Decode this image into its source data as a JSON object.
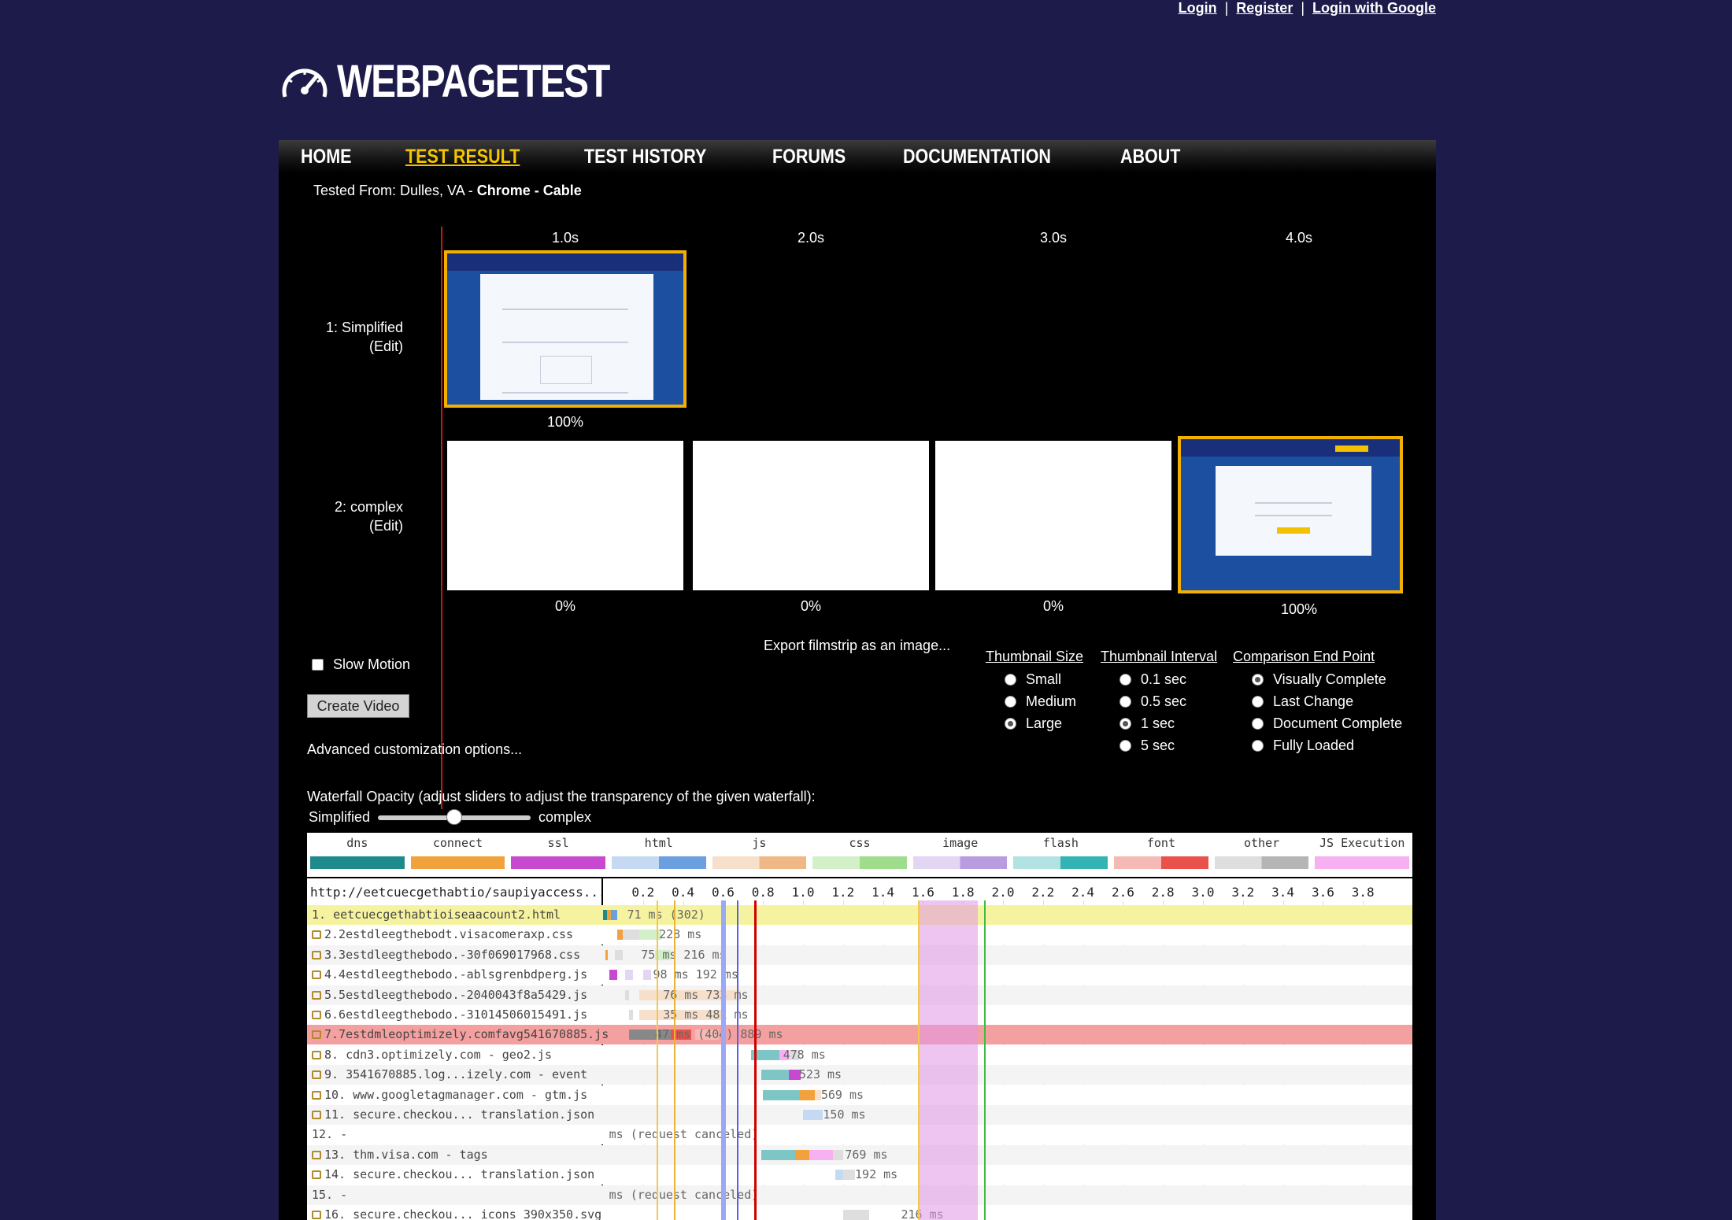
{
  "account": {
    "login": "Login",
    "register": "Register",
    "login_google": "Login with Google",
    "sep": "|"
  },
  "logo": {
    "text": "WEBPAGETEST",
    "icon": "speedometer-icon"
  },
  "nav": [
    "HOME",
    "TEST RESULT",
    "TEST HISTORY",
    "FORUMS",
    "DOCUMENTATION",
    "ABOUT"
  ],
  "nav_active": "TEST RESULT",
  "tested_from": {
    "prefix": "Tested From: Dulles, VA - ",
    "browser": "Chrome",
    "sep": " - ",
    "connection": "Cable"
  },
  "filmstrip": {
    "times": [
      "1.0s",
      "2.0s",
      "3.0s",
      "4.0s"
    ],
    "rows": [
      {
        "label": "1: Simplified",
        "edit": "(Edit)",
        "percents": [
          "100%"
        ]
      },
      {
        "label": "2: complex",
        "edit": "(Edit)",
        "percents": [
          "0%",
          "0%",
          "0%",
          "100%"
        ]
      }
    ]
  },
  "controls": {
    "export": "Export filmstrip as an image...",
    "slow_motion": "Slow Motion",
    "create_video": "Create Video",
    "advanced": "Advanced customization options...",
    "thumbnail_size": {
      "title": "Thumbnail Size",
      "options": [
        "Small",
        "Medium",
        "Large"
      ],
      "selected": "Large"
    },
    "thumbnail_interval": {
      "title": "Thumbnail Interval",
      "options": [
        "0.1 sec",
        "0.5 sec",
        "1 sec",
        "5 sec"
      ],
      "selected": "1 sec"
    },
    "comparison_end": {
      "title": "Comparison End Point",
      "options": [
        "Visually Complete",
        "Last Change",
        "Document Complete",
        "Fully Loaded"
      ],
      "selected": "Visually Complete"
    },
    "opacity_label": "Waterfall Opacity (adjust sliders to adjust the transparency of the given waterfall):",
    "slider_left": "Simplified",
    "slider_right": "complex",
    "slider_value": 0.5
  },
  "waterfall": {
    "legend": [
      {
        "name": "dns",
        "color": "#1f8a8c",
        "light": "#1f8a8c"
      },
      {
        "name": "connect",
        "color": "#f2a23c",
        "light": "#f2a23c"
      },
      {
        "name": "ssl",
        "color": "#c848d0",
        "light": "#c848d0"
      },
      {
        "name": "html",
        "color": "#6a9fe0",
        "light": "#c5d9f2"
      },
      {
        "name": "js",
        "color": "#f0b887",
        "light": "#f7e0cb"
      },
      {
        "name": "css",
        "color": "#9fdc8c",
        "light": "#d3f0c9"
      },
      {
        "name": "image",
        "color": "#b99be0",
        "light": "#e2d6f3"
      },
      {
        "name": "flash",
        "color": "#33b3b3",
        "light": "#b3e2e2"
      },
      {
        "name": "font",
        "color": "#e8524a",
        "light": "#f5bab6"
      },
      {
        "name": "other",
        "color": "#b5b5b5",
        "light": "#dedede"
      },
      {
        "name": "JS Execution",
        "color": "#f7b0f2",
        "light": "#f7b0f2"
      }
    ],
    "url_header": "http://eetcuecgethabtio/saupiyaccess...",
    "ticks": [
      "0.2",
      "0.4",
      "0.6",
      "0.8",
      "1.0",
      "1.2",
      "1.4",
      "1.6",
      "1.8",
      "2.0",
      "2.2",
      "2.4",
      "2.6",
      "2.8",
      "3.0",
      "3.2",
      "3.4",
      "3.6",
      "3.8"
    ],
    "rows": [
      {
        "label": "1. eetcuecgethabtioiseaacount2.html",
        "time": "71 ms (302)",
        "highlight": "#f6f3a0"
      },
      {
        "label": "2.2estdleegthebodt.visacomeraxp.css",
        "time": "228 ms",
        "highlight": ""
      },
      {
        "label": "3.3estdleegthebodo.-30f069017968.css",
        "time": "75 ms    216 ms",
        "highlight": ""
      },
      {
        "label": "4.4estdleegthebodo.-ablsgrenbdperg.js",
        "time": "98 ms 192 ms",
        "highlight": ""
      },
      {
        "label": "5.5estdleegthebodo.-2040043f8a5429.js",
        "time": "76 ms               733 ms",
        "highlight": ""
      },
      {
        "label": "6.6estdleegthebodo.-31014506015491.js",
        "time": "35 ms             481 ms",
        "highlight": ""
      },
      {
        "label": "7.7estdmleoptimizely.comfavg541670885.js",
        "time": "47 ms (404)    889 ms",
        "highlight": "#f5a0a0"
      },
      {
        "label": "8. cdn3.optimizely.com - geo2.js",
        "time": "478 ms",
        "highlight": ""
      },
      {
        "label": "9. 3541670885.log...izely.com - event",
        "time": "523 ms",
        "highlight": ""
      },
      {
        "label": "10. www.googletagmanager.com - gtm.js",
        "time": "569 ms",
        "highlight": ""
      },
      {
        "label": "11. secure.checkou... translation.json",
        "time": "150 ms",
        "highlight": ""
      },
      {
        "label": "12. -",
        "time": "ms (request canceled)",
        "highlight": ""
      },
      {
        "label": "13. thm.visa.com - tags",
        "time": "769 ms",
        "highlight": ""
      },
      {
        "label": "14. secure.checkou... translation.json",
        "time": "192 ms",
        "highlight": ""
      },
      {
        "label": "15. -",
        "time": "ms (request canceled)",
        "highlight": ""
      },
      {
        "label": "16. secure.checkou... icons_390x350.svg",
        "time": "216 ms",
        "highlight": ""
      }
    ]
  }
}
